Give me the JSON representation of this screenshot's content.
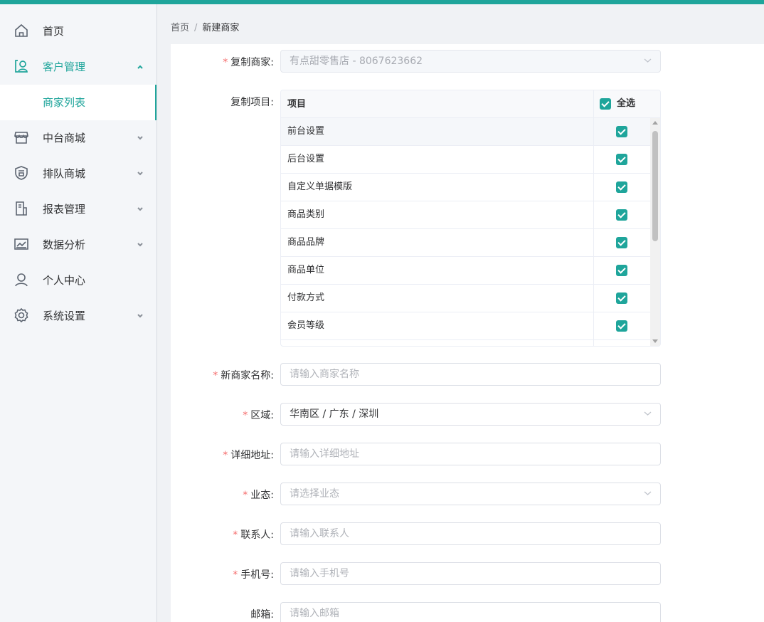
{
  "colors": {
    "accent": "#1fa59b",
    "required": "#f56c6c"
  },
  "sidebar": {
    "items": [
      {
        "label": "首页",
        "icon": "home-icon"
      },
      {
        "label": "客户管理",
        "icon": "customer-icon",
        "active": true
      },
      {
        "label": "商家列表",
        "submenu": true
      },
      {
        "label": "中台商城",
        "icon": "store-icon"
      },
      {
        "label": "排队商城",
        "icon": "shield-icon"
      },
      {
        "label": "报表管理",
        "icon": "report-icon"
      },
      {
        "label": "数据分析",
        "icon": "chart-icon"
      },
      {
        "label": "个人中心",
        "icon": "user-icon"
      },
      {
        "label": "系统设置",
        "icon": "gear-icon"
      }
    ]
  },
  "breadcrumb": {
    "home": "首页",
    "separator": "/",
    "current": "新建商家"
  },
  "form": {
    "copy_merchant": {
      "label": "复制商家:",
      "value": "有点甜零售店 - 8067623662"
    },
    "copy_items": {
      "label": "复制项目:",
      "col_item": "项目",
      "col_select_all": "全选",
      "rows": [
        "前台设置",
        "后台设置",
        "自定义单据模版",
        "商品类别",
        "商品品牌",
        "商品单位",
        "付款方式",
        "会员等级"
      ]
    },
    "merchant_name": {
      "label": "新商家名称:",
      "placeholder": "请输入商家名称"
    },
    "region": {
      "label": "区域:",
      "value": "华南区 / 广东 / 深圳"
    },
    "address": {
      "label": "详细地址:",
      "placeholder": "请输入详细地址"
    },
    "business_type": {
      "label": "业态:",
      "placeholder": "请选择业态"
    },
    "contact": {
      "label": "联系人:",
      "placeholder": "请输入联系人"
    },
    "phone": {
      "label": "手机号:",
      "placeholder": "请输入手机号"
    },
    "email": {
      "label": "邮箱:",
      "placeholder": "请输入邮箱"
    }
  }
}
